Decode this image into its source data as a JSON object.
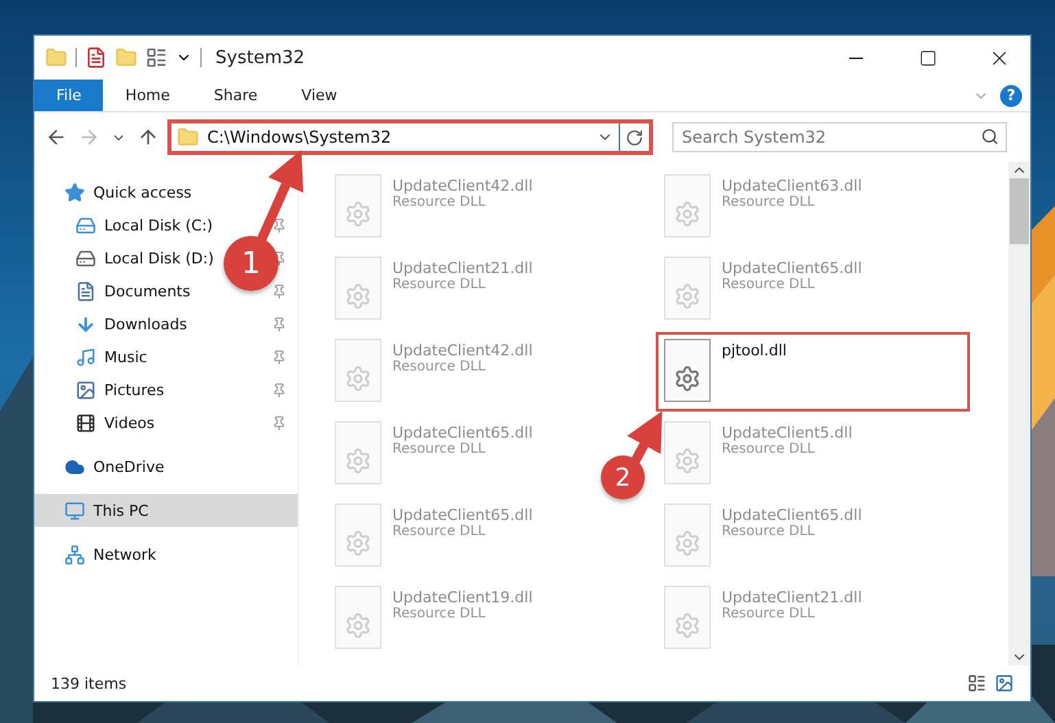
{
  "window": {
    "title": "System32"
  },
  "ribbon": {
    "tabs": [
      {
        "label": "File",
        "selected": true
      },
      {
        "label": "Home",
        "selected": false
      },
      {
        "label": "Share",
        "selected": false
      },
      {
        "label": "View",
        "selected": false
      }
    ],
    "help": "?"
  },
  "address": {
    "path": "C:\\Windows\\System32",
    "marked": true
  },
  "search": {
    "placeholder": "Search System32"
  },
  "sidebar": {
    "items": [
      {
        "label": "Quick access",
        "kind": "star",
        "selected": false,
        "children": [
          {
            "label": "Local Disk (C:)",
            "kind": "system-drive",
            "pinned": true,
            "selected": false
          },
          {
            "label": "Local Disk (D:)",
            "kind": "drive",
            "pinned": true,
            "selected": false
          },
          {
            "label": "Documents",
            "kind": "documents",
            "pinned": true,
            "selected": false
          },
          {
            "label": "Downloads",
            "kind": "downloads",
            "pinned": true,
            "selected": false
          },
          {
            "label": "Music",
            "kind": "music",
            "pinned": true,
            "selected": false
          },
          {
            "label": "Pictures",
            "kind": "pictures",
            "pinned": true,
            "selected": false
          },
          {
            "label": "Videos",
            "kind": "videos",
            "pinned": true,
            "selected": false
          }
        ]
      },
      {
        "label": "OneDrive",
        "kind": "cloud",
        "selected": false
      },
      {
        "label": "This PC",
        "kind": "computer",
        "selected": true
      },
      {
        "label": "Network",
        "kind": "network",
        "selected": false
      }
    ]
  },
  "files": [
    {
      "name": "UpdateClient42.dll",
      "type": "Resource DLL",
      "blurred": true,
      "marked": false
    },
    {
      "name": "UpdateClient63.dll",
      "type": "Resource DLL",
      "blurred": true,
      "marked": false
    },
    {
      "name": "UpdateClient21.dll",
      "type": "Resource DLL",
      "blurred": true,
      "marked": false
    },
    {
      "name": "UpdateClient65.dll",
      "type": "Resource DLL",
      "blurred": true,
      "marked": false
    },
    {
      "name": "UpdateClient42.dll",
      "type": "Resource DLL",
      "blurred": true,
      "marked": false
    },
    {
      "name": "pjtool.dll",
      "blurred": false,
      "marked": true
    },
    {
      "name": "UpdateClient65.dll",
      "type": "Resource DLL",
      "blurred": true,
      "marked": false
    },
    {
      "name": "UpdateClient5.dll",
      "type": "Resource DLL",
      "blurred": true,
      "marked": false
    },
    {
      "name": "UpdateClient65.dll",
      "type": "Resource DLL",
      "blurred": true,
      "marked": false
    },
    {
      "name": "UpdateClient65.dll",
      "type": "Resource DLL",
      "blurred": true,
      "marked": false
    },
    {
      "name": "UpdateClient19.dll",
      "type": "Resource DLL",
      "blurred": true,
      "marked": false
    },
    {
      "name": "UpdateClient21.dll",
      "type": "Resource DLL",
      "blurred": true,
      "marked": false
    }
  ],
  "status_bar": {
    "count": "139 items"
  },
  "callouts": [
    {
      "label": "1"
    },
    {
      "label": "2"
    }
  ]
}
